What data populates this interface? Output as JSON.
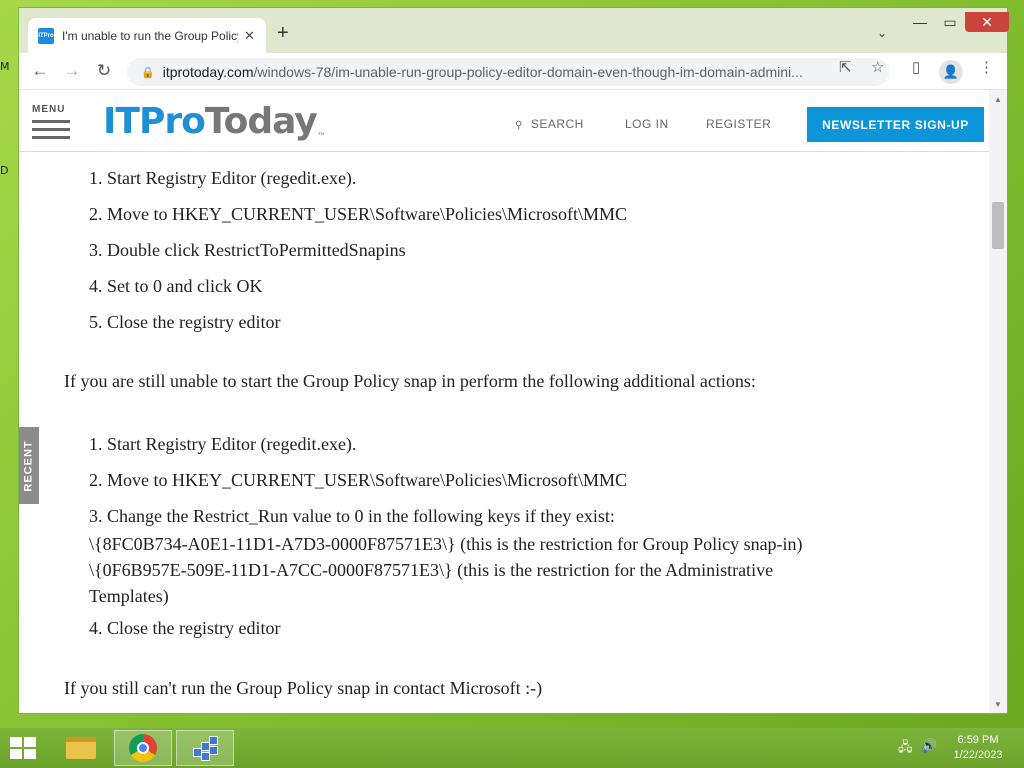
{
  "desktop": {
    "frag1": "M",
    "frag2": "D"
  },
  "browser": {
    "tab": {
      "title": "I'm unable to run the Group Policy",
      "favicon_text": "ITPro",
      "close": "✕"
    },
    "new_tab": "+",
    "tab_list": "⌄",
    "window_controls": {
      "minimize": "—",
      "restore": "▭",
      "close": "✕"
    },
    "toolbar": {
      "back": "←",
      "forward": "→",
      "reload": "↻",
      "lock": "🔒",
      "share": "⇱",
      "bookmark": "☆",
      "sidepanel": "▯",
      "profile": "👤",
      "menu": "⋮"
    },
    "url": {
      "host": "itprotoday.com",
      "path": "/windows-78/im-unable-run-group-policy-editor-domain-even-though-im-domain-admini..."
    }
  },
  "site": {
    "menu_label": "MENU",
    "logo_a": "ITPro",
    "logo_b": "Today",
    "logo_tm": "™",
    "search_icon": "⚲",
    "search": "SEARCH",
    "login": "LOG IN",
    "register": "REGISTER",
    "newsletter": "NEWSLETTER SIGN-UP",
    "recent": "RECENT"
  },
  "article": {
    "list1": [
      "1. Start Registry Editor (regedit.exe).",
      "2. Move to HKEY_CURRENT_USER\\Software\\Policies\\Microsoft\\MMC",
      "3. Double click RestrictToPermittedSnapins",
      "4. Set to 0 and click OK",
      "5. Close the registry editor"
    ],
    "para1": "If you are still unable to start the Group Policy snap in perform the following additional actions:",
    "list2": [
      "1. Start Registry Editor (regedit.exe).",
      "2. Move to HKEY_CURRENT_USER\\Software\\Policies\\Microsoft\\MMC",
      "3. Change the Restrict_Run value to 0 in the following keys if they exist:",
      "\\{8FC0B734-A0E1-11D1-A7D3-0000F87571E3\\} (this is the restriction for Group Policy snap-in)",
      "\\{0F6B957E-509E-11D1-A7CC-0000F87571E3\\} (this is the restriction for the Administrative",
      "Templates)",
      "4. Close the registry editor"
    ],
    "para2": "If you still can't run the Group Policy snap in contact Microsoft :-)"
  },
  "scrollbar": {
    "up": "▲",
    "down": "▼"
  },
  "taskbar": {
    "tray_network": "🖧",
    "tray_volume": "🔊",
    "time": "6:59 PM",
    "date": "1/22/2023"
  }
}
